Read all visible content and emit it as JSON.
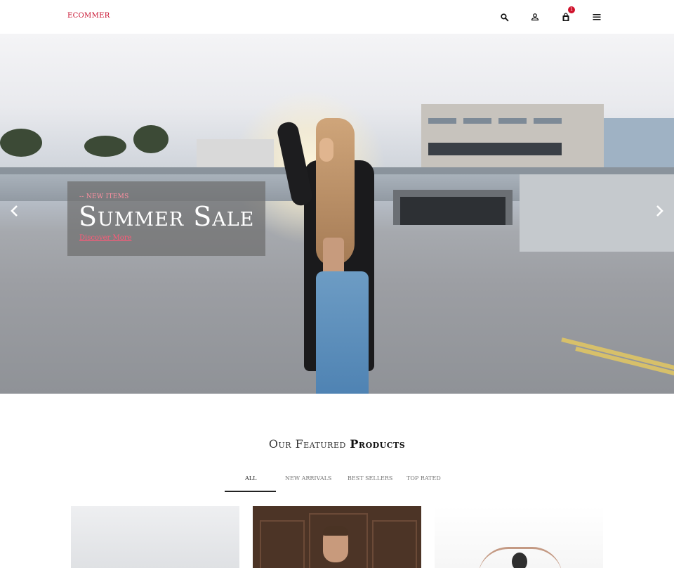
{
  "header": {
    "logo": "ECOMMER",
    "icons": [
      "search-icon",
      "user-icon",
      "shopping-bag-icon",
      "menu-icon"
    ],
    "cart_count": "1",
    "accent_color": "#c8102e"
  },
  "hero": {
    "eyebrow": "-- NEW ITEMS",
    "title": "Summer Sale",
    "link": "Discover More",
    "prev_icon": "chevron-left-icon",
    "next_icon": "chevron-right-icon"
  },
  "featured": {
    "title_light": "Our Featured ",
    "title_bold": "Products",
    "tabs": [
      "ALL",
      "NEW ARRIVALS",
      "BEST SELLERS",
      "TOP RATED"
    ],
    "active_tab": "ALL"
  }
}
